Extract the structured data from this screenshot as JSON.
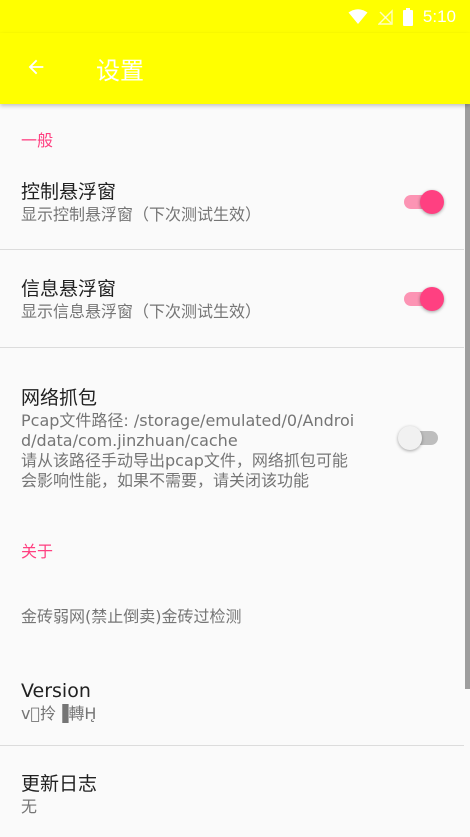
{
  "status_bar": {
    "time": "5:10"
  },
  "toolbar": {
    "title": "设置"
  },
  "sections": {
    "general": {
      "header": "一般",
      "control_float": {
        "title": "控制悬浮窗",
        "summary": "显示控制悬浮窗（下次测试生效）",
        "checked": true
      },
      "info_float": {
        "title": "信息悬浮窗",
        "summary": "显示信息悬浮窗（下次测试生效）",
        "checked": true
      },
      "capture": {
        "title": "网络抓包",
        "summary": "Pcap文件路径: /storage/emulated/0/Android/data/com.jinzhuan/cache\n请从该路径手动导出pcap文件，网络抓包可能会影响性能，如果不需要，请关闭该功能",
        "checked": false
      }
    },
    "about": {
      "header": "关于",
      "app_name": "金砖弱网(禁止倒卖)金砖过检测",
      "version": {
        "title": "Version",
        "summary": "v\u0000拎▐轉H̨"
      },
      "changelog": {
        "title": "更新日志",
        "summary": "无"
      }
    }
  },
  "colors": {
    "primary": "#ffff00",
    "accent": "#ff4081",
    "switch_track_on": "#fc94b4",
    "switch_track_off": "#bdbdbd"
  },
  "icons": {
    "back": "arrow-left-icon",
    "wifi": "wifi-icon",
    "signal": "no-signal-icon",
    "battery": "battery-icon"
  }
}
